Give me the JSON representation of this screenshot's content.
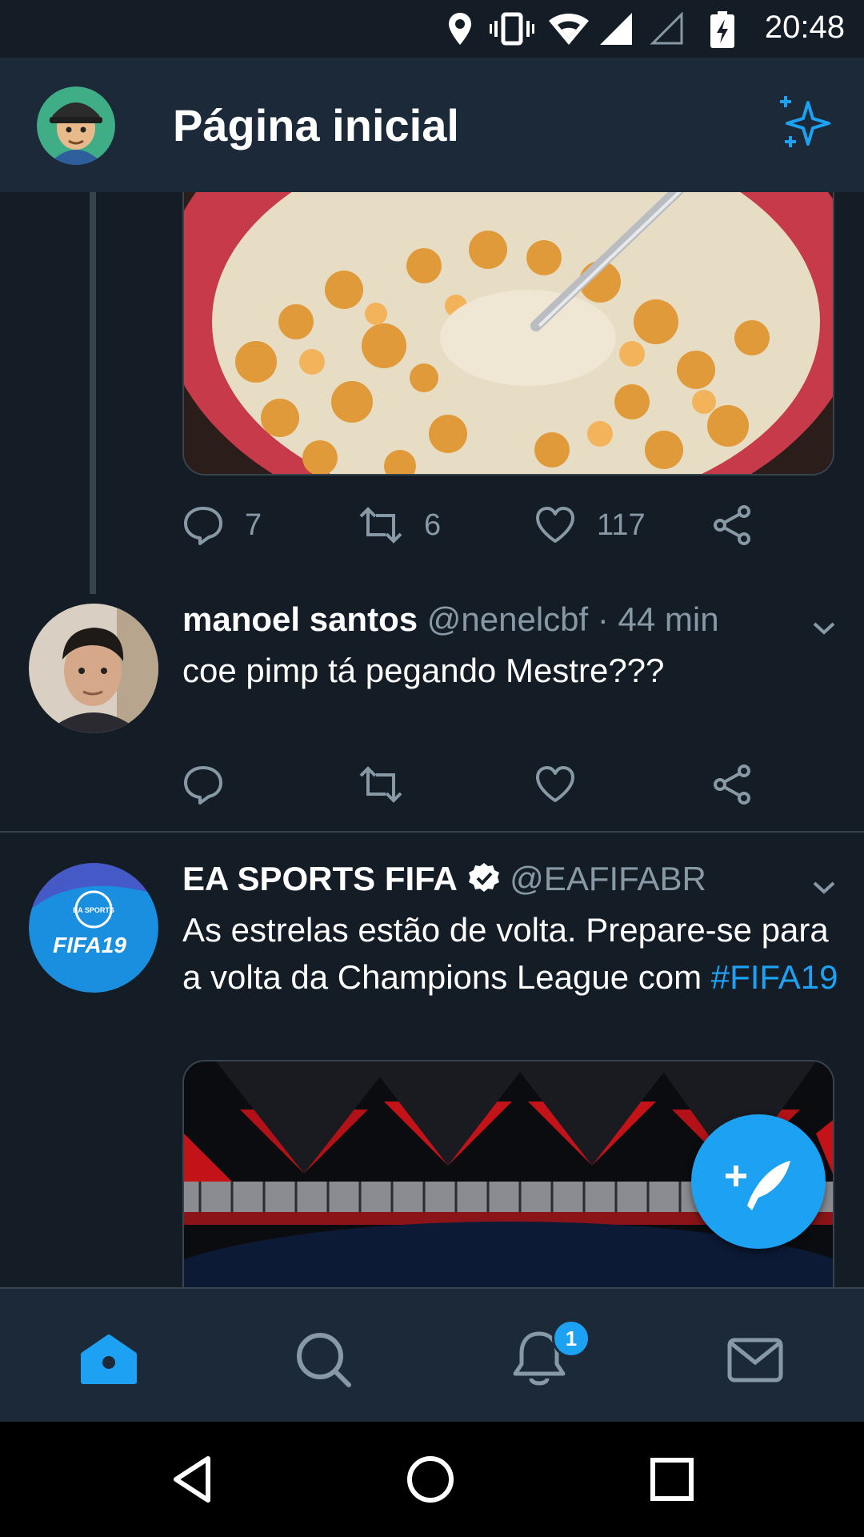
{
  "status_bar": {
    "time": "20:48"
  },
  "app_bar": {
    "title": "Página inicial"
  },
  "tweet_prev": {
    "reply_count": "7",
    "retweet_count": "6",
    "like_count": "117"
  },
  "tweet_1": {
    "name": "manoel santos",
    "handle": "@nenelcbf",
    "separator": " · ",
    "time": "44 min",
    "text": "coe pimp tá pegando Mestre???"
  },
  "tweet_2": {
    "name": "EA SPORTS FIFA",
    "handle": "@EAFIFABR",
    "text": "As estrelas estão de volta. Prepare-se para a volta da Champions League com",
    "hashtag": "#FIFA19",
    "avatar_logo_top": "EA SPORTS",
    "avatar_logo_bottom": "FIFA19"
  },
  "bottom_nav": {
    "notifications_badge": "1"
  },
  "colors": {
    "background": "#141d26",
    "bar": "#1c2938",
    "accent": "#1da1f2",
    "muted": "#8899a6"
  }
}
